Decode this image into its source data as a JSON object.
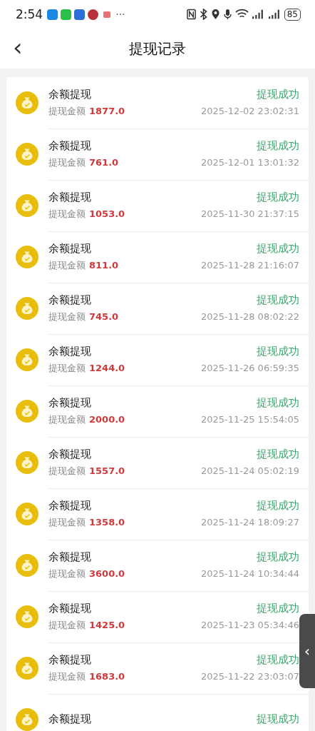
{
  "status_bar": {
    "time": "2:54",
    "more": "···",
    "battery": "85"
  },
  "header": {
    "back": "‹",
    "title": "提现记录"
  },
  "records": [
    {
      "title": "余额提现",
      "status": "提现成功",
      "amount_label": "提现金额",
      "amount": "1877.0",
      "time": "2025-12-02 23:02:31"
    },
    {
      "title": "余额提现",
      "status": "提现成功",
      "amount_label": "提现金额",
      "amount": "761.0",
      "time": "2025-12-01 13:01:32"
    },
    {
      "title": "余额提现",
      "status": "提现成功",
      "amount_label": "提现金额",
      "amount": "1053.0",
      "time": "2025-11-30 21:37:15"
    },
    {
      "title": "余额提现",
      "status": "提现成功",
      "amount_label": "提现金额",
      "amount": "811.0",
      "time": "2025-11-28 21:16:07"
    },
    {
      "title": "余额提现",
      "status": "提现成功",
      "amount_label": "提现金额",
      "amount": "745.0",
      "time": "2025-11-28 08:02:22"
    },
    {
      "title": "余额提现",
      "status": "提现成功",
      "amount_label": "提现金额",
      "amount": "1244.0",
      "time": "2025-11-26 06:59:35"
    },
    {
      "title": "余额提现",
      "status": "提现成功",
      "amount_label": "提现金额",
      "amount": "2000.0",
      "time": "2025-11-25 15:54:05"
    },
    {
      "title": "余额提现",
      "status": "提现成功",
      "amount_label": "提现金额",
      "amount": "1557.0",
      "time": "2025-11-24 05:02:19"
    },
    {
      "title": "余额提现",
      "status": "提现成功",
      "amount_label": "提现金额",
      "amount": "1358.0",
      "time": "2025-11-24 18:09:27"
    },
    {
      "title": "余额提现",
      "status": "提现成功",
      "amount_label": "提现金额",
      "amount": "3600.0",
      "time": "2025-11-24 10:34:44"
    },
    {
      "title": "余额提现",
      "status": "提现成功",
      "amount_label": "提现金额",
      "amount": "1425.0",
      "time": "2025-11-23 05:34:46"
    },
    {
      "title": "余额提现",
      "status": "提现成功",
      "amount_label": "提现金额",
      "amount": "1683.0",
      "time": "2025-11-22 23:03:07"
    },
    {
      "title": "余额提现",
      "status": "提现成功"
    }
  ],
  "side_handle": {
    "glyph": "‹"
  }
}
